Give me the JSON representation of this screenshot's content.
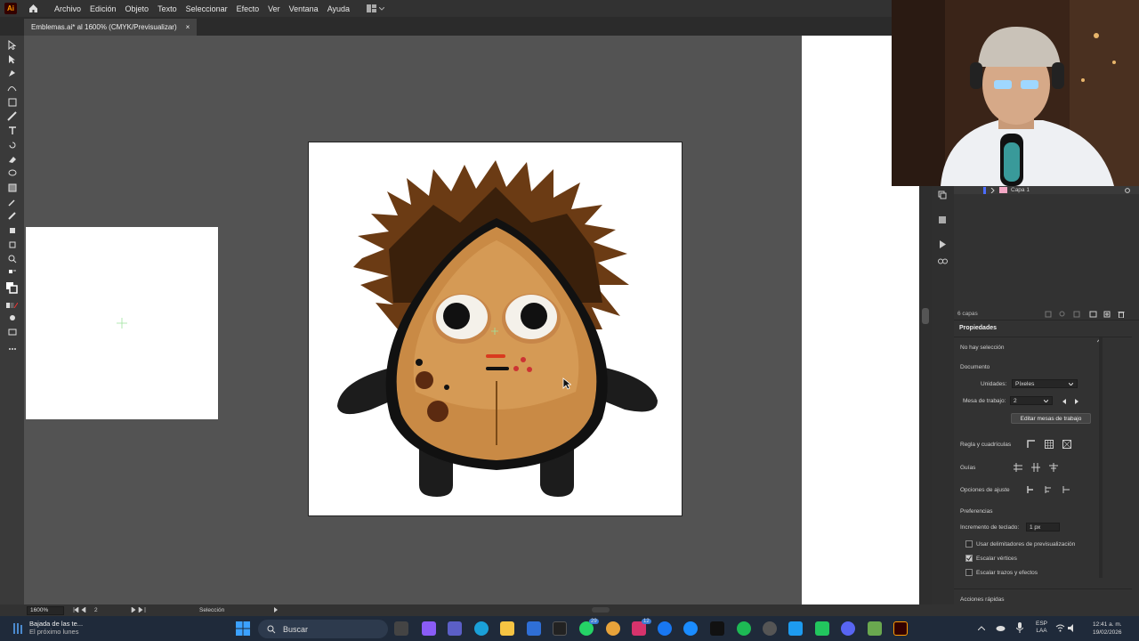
{
  "menubar": {
    "app_logo": "Ai",
    "items": [
      "Archivo",
      "Edición",
      "Objeto",
      "Texto",
      "Seleccionar",
      "Efecto",
      "Ver",
      "Ventana",
      "Ayuda"
    ]
  },
  "document": {
    "tab_title": "Emblemas.ai* al 1600% (CMYK/Previsualizar)",
    "close_symbol": "×"
  },
  "layers": {
    "layer_name": "Capa 1",
    "count_label": "6 capas"
  },
  "properties": {
    "title": "Propiedades",
    "no_selection": "No hay selección",
    "document_section": "Documento",
    "units_label": "Unidades:",
    "units_value": "Píxeles",
    "artboard_label": "Mesa de trabajo:",
    "artboard_value": "2",
    "edit_artboards_button": "Editar mesas de trabajo",
    "rulers_grids_label": "Regla y cuadrículas",
    "guides_label": "Guías",
    "snap_options_label": "Opciones de ajuste",
    "preferences_label": "Preferencias",
    "keyboard_increment_label": "Incremento de teclado:",
    "keyboard_increment_value": "1 px",
    "checkboxes": [
      {
        "label": "Usar delimitadores de previsualización",
        "checked": false
      },
      {
        "label": "Escalar vértices",
        "checked": true
      },
      {
        "label": "Escalar trazos y efectos",
        "checked": false
      }
    ],
    "quick_actions_label": "Acciones rápidas"
  },
  "statusbar": {
    "zoom": "1600%",
    "artboard_nav": "2",
    "tool": "Selección"
  },
  "taskbar": {
    "notification_title": "Bajada de las te...",
    "notification_subtitle": "El próximo lunes",
    "search_placeholder": "Buscar",
    "lang_top": "ESP",
    "lang_bottom": "LAA",
    "time": "12:41 a. m.",
    "date": "19/02/2026",
    "badges": [
      "29",
      "12"
    ]
  },
  "colors": {
    "menubar_bg": "#323232",
    "canvas_bg": "#535353",
    "panel_bg": "#323232",
    "accent": "#ff9a00",
    "taskbar_bg": "#1f2a3a"
  }
}
